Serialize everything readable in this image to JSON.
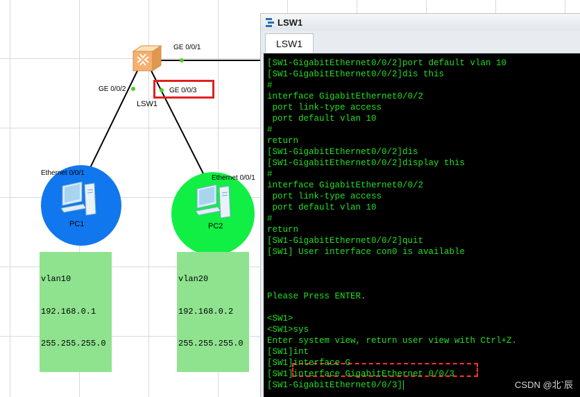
{
  "topology": {
    "switch": {
      "name": "LSW1",
      "icon": "switch-icon"
    },
    "ports": {
      "ge001": "GE 0/0/1",
      "ge002": "GE 0/0/2",
      "ge003": "GE 0/0/3",
      "pc1_eth": "Ethernet 0/0/1",
      "pc2_eth": "Ethernet 0/0/1"
    },
    "pc1": {
      "name": "PC1",
      "color": "#1177ee",
      "icon": "pc-icon",
      "info": [
        "vlan10",
        "192.168.0.1",
        "255.255.255.0"
      ]
    },
    "pc2": {
      "name": "PC2",
      "color": "#11ee44",
      "icon": "pc-icon",
      "info": [
        "vlan20",
        "192.168.0.2",
        "255.255.255.0"
      ]
    },
    "highlight_color": "#e02020"
  },
  "console": {
    "window_title": "LSW1",
    "tab_label": "LSW1",
    "text_color": "#22e022",
    "lines": [
      "[SW1-GigabitEthernet0/0/2]port default vlan 10",
      "[SW1-GigabitEthernet0/0/2]dis this",
      "#",
      "interface GigabitEthernet0/0/2",
      " port link-type access",
      " port default vlan 10",
      "#",
      "return",
      "[SW1-GigabitEthernet0/0/2]dis",
      "[SW1-GigabitEthernet0/0/2]display this",
      "#",
      "interface GigabitEthernet0/0/2",
      " port link-type access",
      " port default vlan 10",
      "#",
      "return",
      "[SW1-GigabitEthernet0/0/2]quit",
      "[SW1] User interface con0 is available",
      "",
      "",
      "",
      "Please Press ENTER.",
      "",
      "<SW1>",
      "<SW1>sys",
      "Enter system view, return user view with Ctrl+Z.",
      "[SW1]int",
      "[SW1]interface G",
      "[SW1]interface GigabitEthernet 0/0/3",
      "[SW1-GigabitEthernet0/0/3]"
    ]
  },
  "watermark": "CSDN @北`辰"
}
